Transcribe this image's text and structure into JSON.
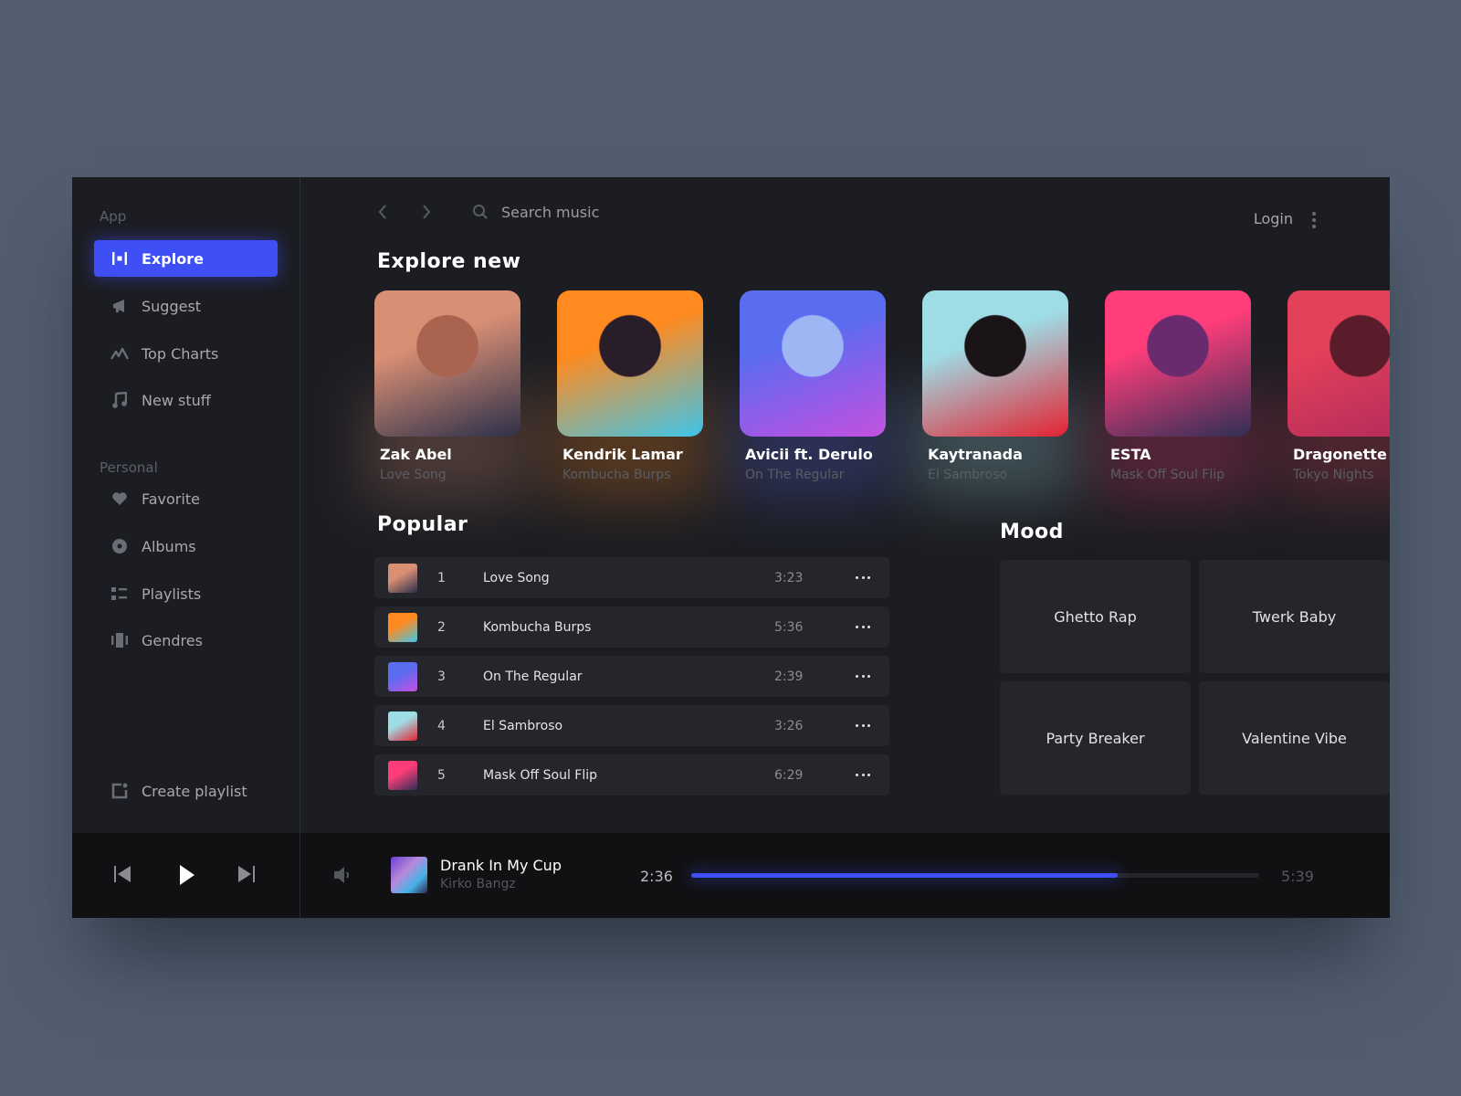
{
  "colors": {
    "accent": "#3d4ff5",
    "page_bg": "#525e70",
    "app_bg": "#1c1d22",
    "row_bg": "#25262c",
    "player_bg": "#111113"
  },
  "sidebar": {
    "app_section_label": "App",
    "app_items": [
      {
        "label": "Explore",
        "icon": "explore-icon",
        "active": true
      },
      {
        "label": "Suggest",
        "icon": "megaphone-icon",
        "active": false
      },
      {
        "label": "Top Charts",
        "icon": "chart-line-icon",
        "active": false
      },
      {
        "label": "New stuff",
        "icon": "music-note-icon",
        "active": false
      }
    ],
    "personal_section_label": "Personal",
    "personal_items": [
      {
        "label": "Favorite",
        "icon": "heart-icon"
      },
      {
        "label": "Albums",
        "icon": "disc-icon"
      },
      {
        "label": "Playlists",
        "icon": "list-icon"
      },
      {
        "label": "Gendres",
        "icon": "genres-icon"
      }
    ],
    "create_playlist_label": "Create playlist"
  },
  "topbar": {
    "search_placeholder": "Search music",
    "login_label": "Login"
  },
  "explore": {
    "heading": "Explore new",
    "cards": [
      {
        "artist": "Zak Abel",
        "song": "Love Song",
        "art": [
          "#d98f74",
          "#a9634f",
          "#2a2f4a"
        ]
      },
      {
        "artist": "Kendrik Lamar",
        "song": "Kombucha Burps",
        "art": [
          "#ff8a1f",
          "#2a1d2a",
          "#3fc6ea"
        ]
      },
      {
        "artist": "Avicii ft. Derulo",
        "song": "On The Regular",
        "art": [
          "#5a6cf0",
          "#9fb6f5",
          "#c54fe0"
        ]
      },
      {
        "artist": "Kaytranada",
        "song": "El Sambroso",
        "art": [
          "#9fdde6",
          "#1b1416",
          "#e32230"
        ]
      },
      {
        "artist": "ESTA",
        "song": "Mask Off Soul Flip",
        "art": [
          "#ff3d7a",
          "#6a2a6e",
          "#2c2f55"
        ]
      },
      {
        "artist": "Dragonette",
        "song": "Tokyo Nights",
        "art": [
          "#e3405a",
          "#5a1c2a",
          "#b22a5b"
        ]
      }
    ]
  },
  "popular": {
    "heading": "Popular",
    "tracks": [
      {
        "rank": "1",
        "title": "Love Song",
        "duration": "3:23",
        "art": [
          "#d98f74",
          "#2a2f4a"
        ]
      },
      {
        "rank": "2",
        "title": "Kombucha Burps",
        "duration": "5:36",
        "art": [
          "#ff8a1f",
          "#3fc6ea"
        ]
      },
      {
        "rank": "3",
        "title": "On The Regular",
        "duration": "2:39",
        "art": [
          "#5a6cf0",
          "#c54fe0"
        ]
      },
      {
        "rank": "4",
        "title": "El Sambroso",
        "duration": "3:26",
        "art": [
          "#9fdde6",
          "#e32230"
        ]
      },
      {
        "rank": "5",
        "title": "Mask Off Soul Flip",
        "duration": "6:29",
        "art": [
          "#ff3d7a",
          "#2c2f55"
        ]
      }
    ]
  },
  "mood": {
    "heading": "Mood",
    "tiles": [
      "Ghetto Rap",
      "Twerk Baby",
      "Party Breaker",
      "Valentine Vibe"
    ]
  },
  "player": {
    "title": "Drank In My Cup",
    "artist": "Kirko Bangz",
    "current_time": "2:36",
    "total_time": "5:39",
    "progress_fraction": 0.75
  }
}
